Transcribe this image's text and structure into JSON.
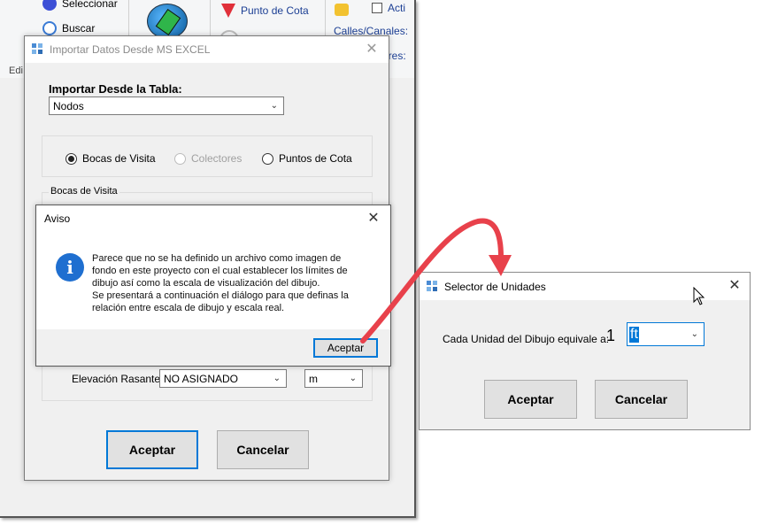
{
  "ribbon": {
    "seleccionar": "Seleccionar",
    "buscar": "Buscar",
    "edit_group": "Edi",
    "punto_de_cota": "Punto de Cota",
    "actividad": "Acti",
    "calles_canales": "Calles/Canales:",
    "colectores_partial": "ores:"
  },
  "import_dialog": {
    "title": "Importar Datos Desde MS EXCEL",
    "table_label": "Importar Desde la Tabla:",
    "table_value": "Nodos",
    "radios": [
      {
        "label": "Bocas de Visita",
        "selected": true,
        "enabled": true
      },
      {
        "label": "Colectores",
        "selected": false,
        "enabled": false
      },
      {
        "label": "Puntos de Cota",
        "selected": false,
        "enabled": true
      }
    ],
    "group_label": "Bocas de Visita",
    "elevation_label": "Elevación Rasante:",
    "elevation_value": "NO ASIGNADO",
    "unit_value": "m",
    "accept": "Aceptar",
    "cancel": "Cancelar"
  },
  "notice_dialog": {
    "title": "Aviso",
    "message_lines": [
      "Parece que no se ha definido un archivo como imagen de",
      "fondo en este proyecto con el cual establecer los límites de",
      "dibujo así como la escala de visualización del dibujo.",
      "Se presentará a continuación el diálogo para que definas la",
      "relación entre escala de dibujo y escala real."
    ],
    "accept": "Aceptar"
  },
  "units_dialog": {
    "title": "Selector de Unidades",
    "label": "Cada Unidad del Dibujo equivale a:",
    "number": "1",
    "unit_value": "ft",
    "accept": "Aceptar",
    "cancel": "Cancelar"
  },
  "colors": {
    "arrow": "#e8414b",
    "info_icon": "#1f6fd0",
    "focus_border": "#0078d7"
  }
}
